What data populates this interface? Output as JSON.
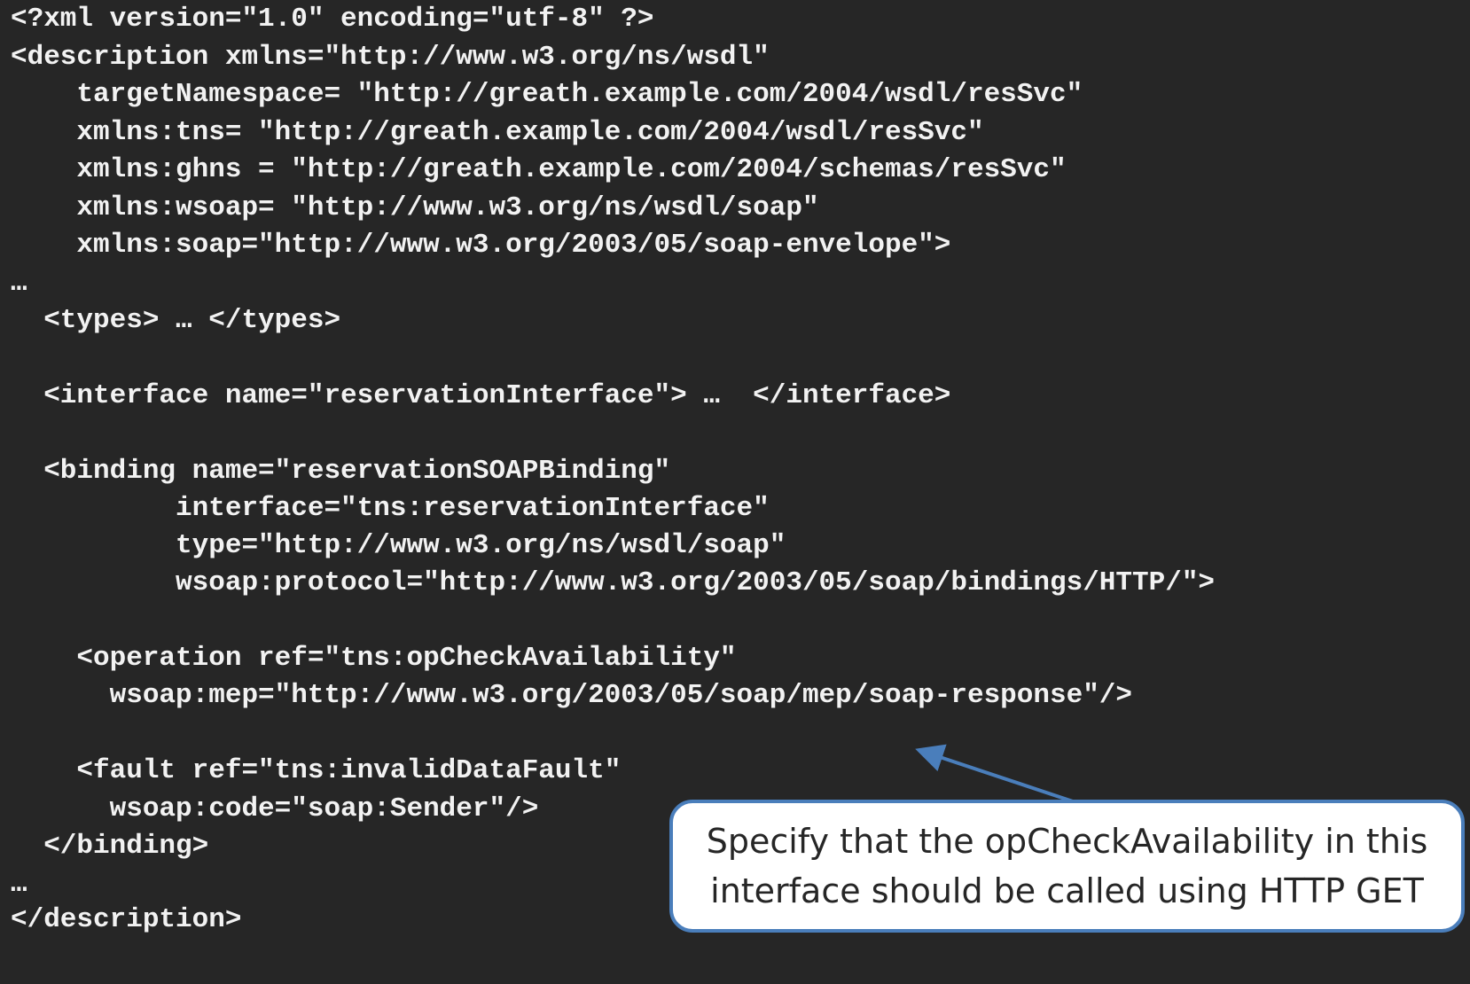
{
  "code_lines": [
    "<?xml version=\"1.0\" encoding=\"utf-8\" ?>",
    "<description xmlns=\"http://www.w3.org/ns/wsdl\"",
    "    targetNamespace= \"http://greath.example.com/2004/wsdl/resSvc\"",
    "    xmlns:tns= \"http://greath.example.com/2004/wsdl/resSvc\"",
    "    xmlns:ghns = \"http://greath.example.com/2004/schemas/resSvc\"",
    "    xmlns:wsoap= \"http://www.w3.org/ns/wsdl/soap\"",
    "    xmlns:soap=\"http://www.w3.org/2003/05/soap-envelope\">",
    "…",
    "  <types> … </types>",
    "",
    "  <interface name=\"reservationInterface\"> …  </interface>",
    "",
    "  <binding name=\"reservationSOAPBinding\"",
    "          interface=\"tns:reservationInterface\"",
    "          type=\"http://www.w3.org/ns/wsdl/soap\"",
    "          wsoap:protocol=\"http://www.w3.org/2003/05/soap/bindings/HTTP/\">",
    "",
    "    <operation ref=\"tns:opCheckAvailability\"",
    "      wsoap:mep=\"http://www.w3.org/2003/05/soap/mep/soap-response\"/>",
    "",
    "    <fault ref=\"tns:invalidDataFault\"",
    "      wsoap:code=\"soap:Sender\"/>",
    "  </binding>",
    "…",
    "</description>"
  ],
  "callout": {
    "line1": "Specify that the opCheckAvailability in this",
    "line2": "interface should be called using HTTP GET"
  },
  "colors": {
    "background": "#262626",
    "code_text": "#f2f2f2",
    "callout_border": "#4a7ebb",
    "arrow": "#4a7ebb"
  }
}
